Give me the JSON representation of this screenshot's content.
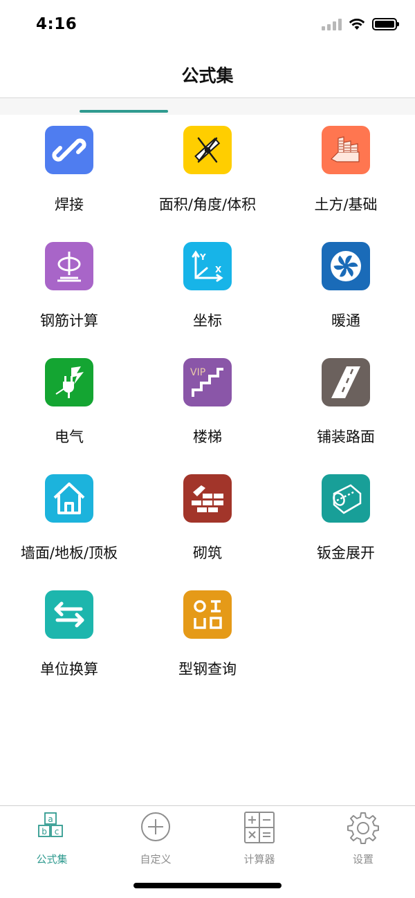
{
  "status_bar": {
    "time": "4:16"
  },
  "header": {
    "title": "公式集"
  },
  "colors": {
    "accent": "#2f9a8f",
    "inactive": "#8e8e8e"
  },
  "grid": {
    "items": [
      {
        "label": "焊接",
        "icon": "chain-link-icon",
        "color": "#4f7df0"
      },
      {
        "label": "面积/角度/体积",
        "icon": "ruler-compass-icon",
        "color": "#ffce00"
      },
      {
        "label": "土方/基础",
        "icon": "excavation-icon",
        "color": "#ff7650"
      },
      {
        "label": "钢筋计算",
        "icon": "rebar-icon",
        "color": "#a865c8"
      },
      {
        "label": "坐标",
        "icon": "xy-axis-icon",
        "color": "#17b4e8"
      },
      {
        "label": "暖通",
        "icon": "fan-icon",
        "color": "#1a6bb8"
      },
      {
        "label": "电气",
        "icon": "electric-plug-icon",
        "color": "#14a532"
      },
      {
        "label": "楼梯",
        "icon": "stairs-icon",
        "color": "#8a56a8",
        "badge": "VIP"
      },
      {
        "label": "铺装路面",
        "icon": "road-icon",
        "color": "#6b615d"
      },
      {
        "label": "墙面/地板/顶板",
        "icon": "house-icon",
        "color": "#1cb3dc"
      },
      {
        "label": "砌筑",
        "icon": "brick-wall-icon",
        "color": "#a2352a"
      },
      {
        "label": "钣金展开",
        "icon": "sheet-metal-icon",
        "color": "#189f98"
      },
      {
        "label": "单位换算",
        "icon": "swap-arrows-icon",
        "color": "#1db6ad"
      },
      {
        "label": "型钢查询",
        "icon": "steel-profile-icon",
        "color": "#e59a18"
      }
    ]
  },
  "tab_bar": {
    "items": [
      {
        "label": "公式集",
        "icon": "abc-blocks-icon",
        "active": true
      },
      {
        "label": "自定义",
        "icon": "plus-circle-icon",
        "active": false
      },
      {
        "label": "计算器",
        "icon": "calculator-icon",
        "active": false
      },
      {
        "label": "设置",
        "icon": "gear-icon",
        "active": false
      }
    ]
  }
}
